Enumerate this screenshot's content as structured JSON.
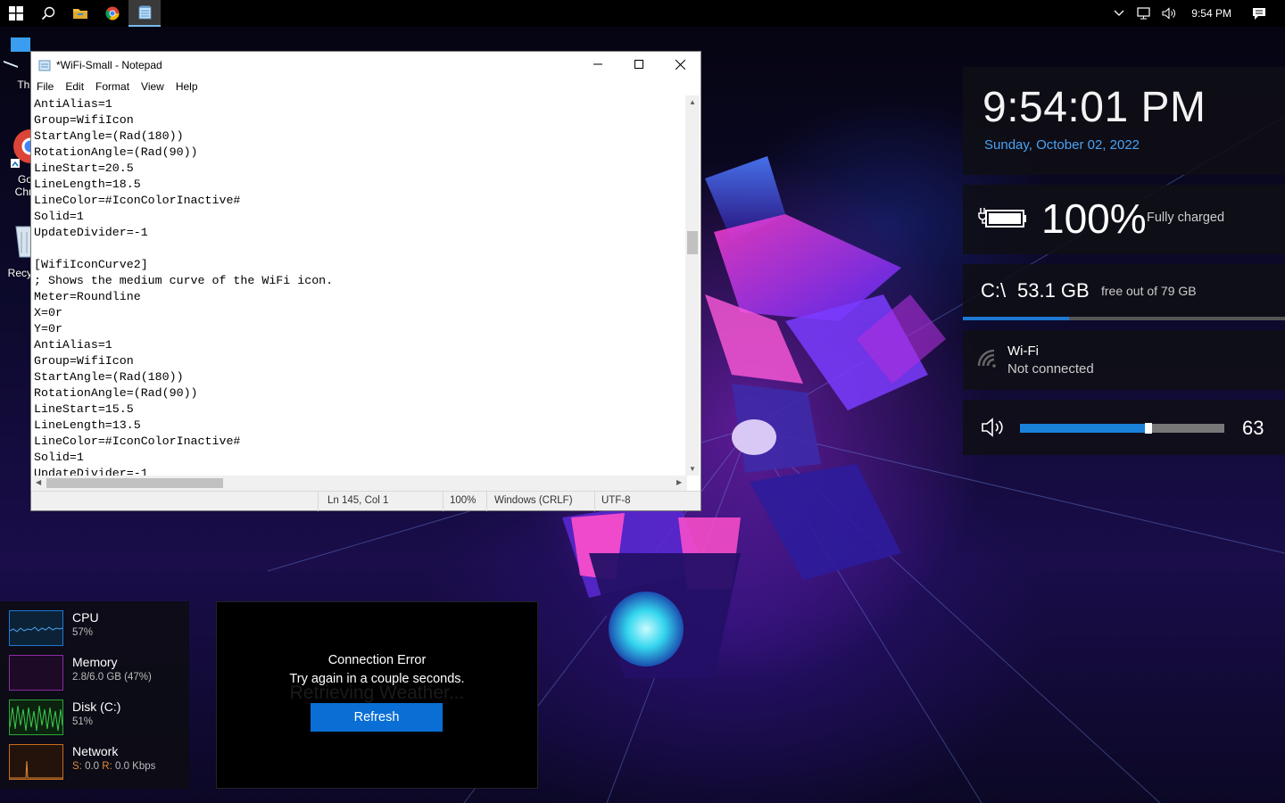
{
  "taskbar": {
    "clock": "9:54 PM",
    "pinned": [
      "start-icon",
      "search-icon",
      "file-explorer-icon",
      "chrome-icon",
      "notepad-icon"
    ]
  },
  "desktop_icons": [
    {
      "label": "Thi",
      "icon": "this-pc-icon"
    },
    {
      "label": "Go\nChr",
      "icon": "chrome-icon"
    },
    {
      "label": "Recy",
      "icon": "recycle-bin-icon"
    }
  ],
  "notepad": {
    "title": "*WiFi-Small - Notepad",
    "menu": [
      "File",
      "Edit",
      "Format",
      "View",
      "Help"
    ],
    "content": "AntiAlias=1\nGroup=WifiIcon\nStartAngle=(Rad(180))\nRotationAngle=(Rad(90))\nLineStart=20.5\nLineLength=18.5\nLineColor=#IconColorInactive#\nSolid=1\nUpdateDivider=-1\n\n[WifiIconCurve2]\n; Shows the medium curve of the WiFi icon.\nMeter=Roundline\nX=0r\nY=0r\nAntiAlias=1\nGroup=WifiIcon\nStartAngle=(Rad(180))\nRotationAngle=(Rad(90))\nLineStart=15.5\nLineLength=13.5\nLineColor=#IconColorInactive#\nSolid=1\nUpdateDivider=-1",
    "status": {
      "position": "Ln 145, Col 1",
      "zoom": "100%",
      "line_endings": "Windows (CRLF)",
      "encoding": "UTF-8"
    }
  },
  "widgets": {
    "clock": {
      "time": "9:54:01 PM",
      "date": "Sunday, October 02, 2022"
    },
    "battery": {
      "percent_label": "100%",
      "status": "Fully charged"
    },
    "disk": {
      "drive": "C:\\",
      "free": "53.1 GB",
      "label": "free out of 79 GB",
      "fill_fraction": 0.33
    },
    "wifi": {
      "name": "Wi-Fi",
      "status": "Not connected"
    },
    "volume": {
      "value": "63",
      "level": 0.63
    }
  },
  "system_monitor": [
    {
      "name": "CPU",
      "value": "57%",
      "color": "#1e78d2"
    },
    {
      "name": "Memory",
      "value": "2.8/6.0 GB (47%)",
      "color": "#8a2ba3"
    },
    {
      "name": "Disk (C:)",
      "value": "51%",
      "color": "#2fa33a"
    },
    {
      "name": "Network",
      "value_s_label": "S:",
      "value_s": "0.0",
      "value_r_label": "R:",
      "value_r": "0.0 Kbps",
      "color": "#c86b1e"
    }
  ],
  "weather": {
    "error_title": "Connection Error",
    "error_message": "Try again in a couple seconds.",
    "ghost_text": "Retrieving Weather...",
    "button": "Refresh"
  },
  "colors": {
    "accent": "#1a82d9",
    "date_blue": "#4aa3f2"
  }
}
